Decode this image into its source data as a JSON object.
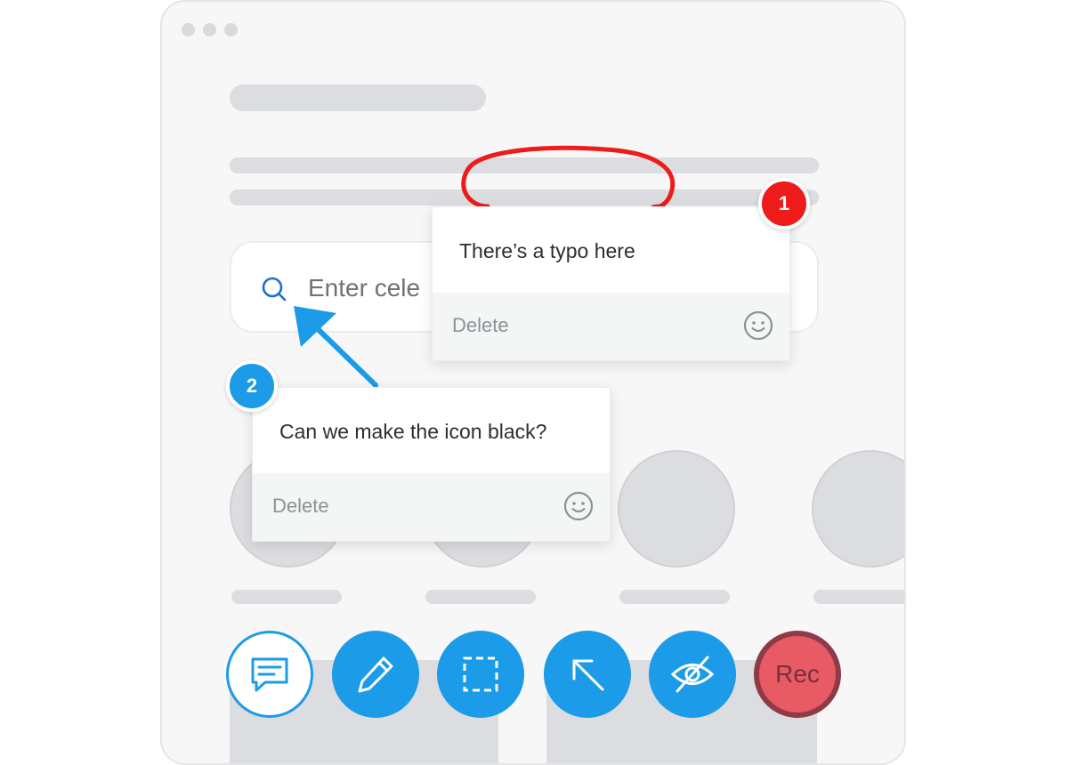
{
  "search": {
    "placeholder": "Enter cele",
    "icon": "search-icon",
    "accent": "#1b6fd0"
  },
  "comments": [
    {
      "number": "1",
      "text": "There’s a typo here",
      "delete_label": "Delete",
      "icon": "smiley-icon",
      "color": "#ee1b1b"
    },
    {
      "number": "2",
      "text": "Can we make the icon black?",
      "delete_label": "Delete",
      "icon": "smiley-icon",
      "color": "#1b9be8"
    }
  ],
  "toolbar": {
    "tools": [
      "comment-icon",
      "pencil-icon",
      "selection-icon",
      "arrow-icon",
      "eye-off-icon"
    ],
    "rec_label": "Rec",
    "accent": "#1b9be8",
    "rec_color": "#e85a64"
  }
}
